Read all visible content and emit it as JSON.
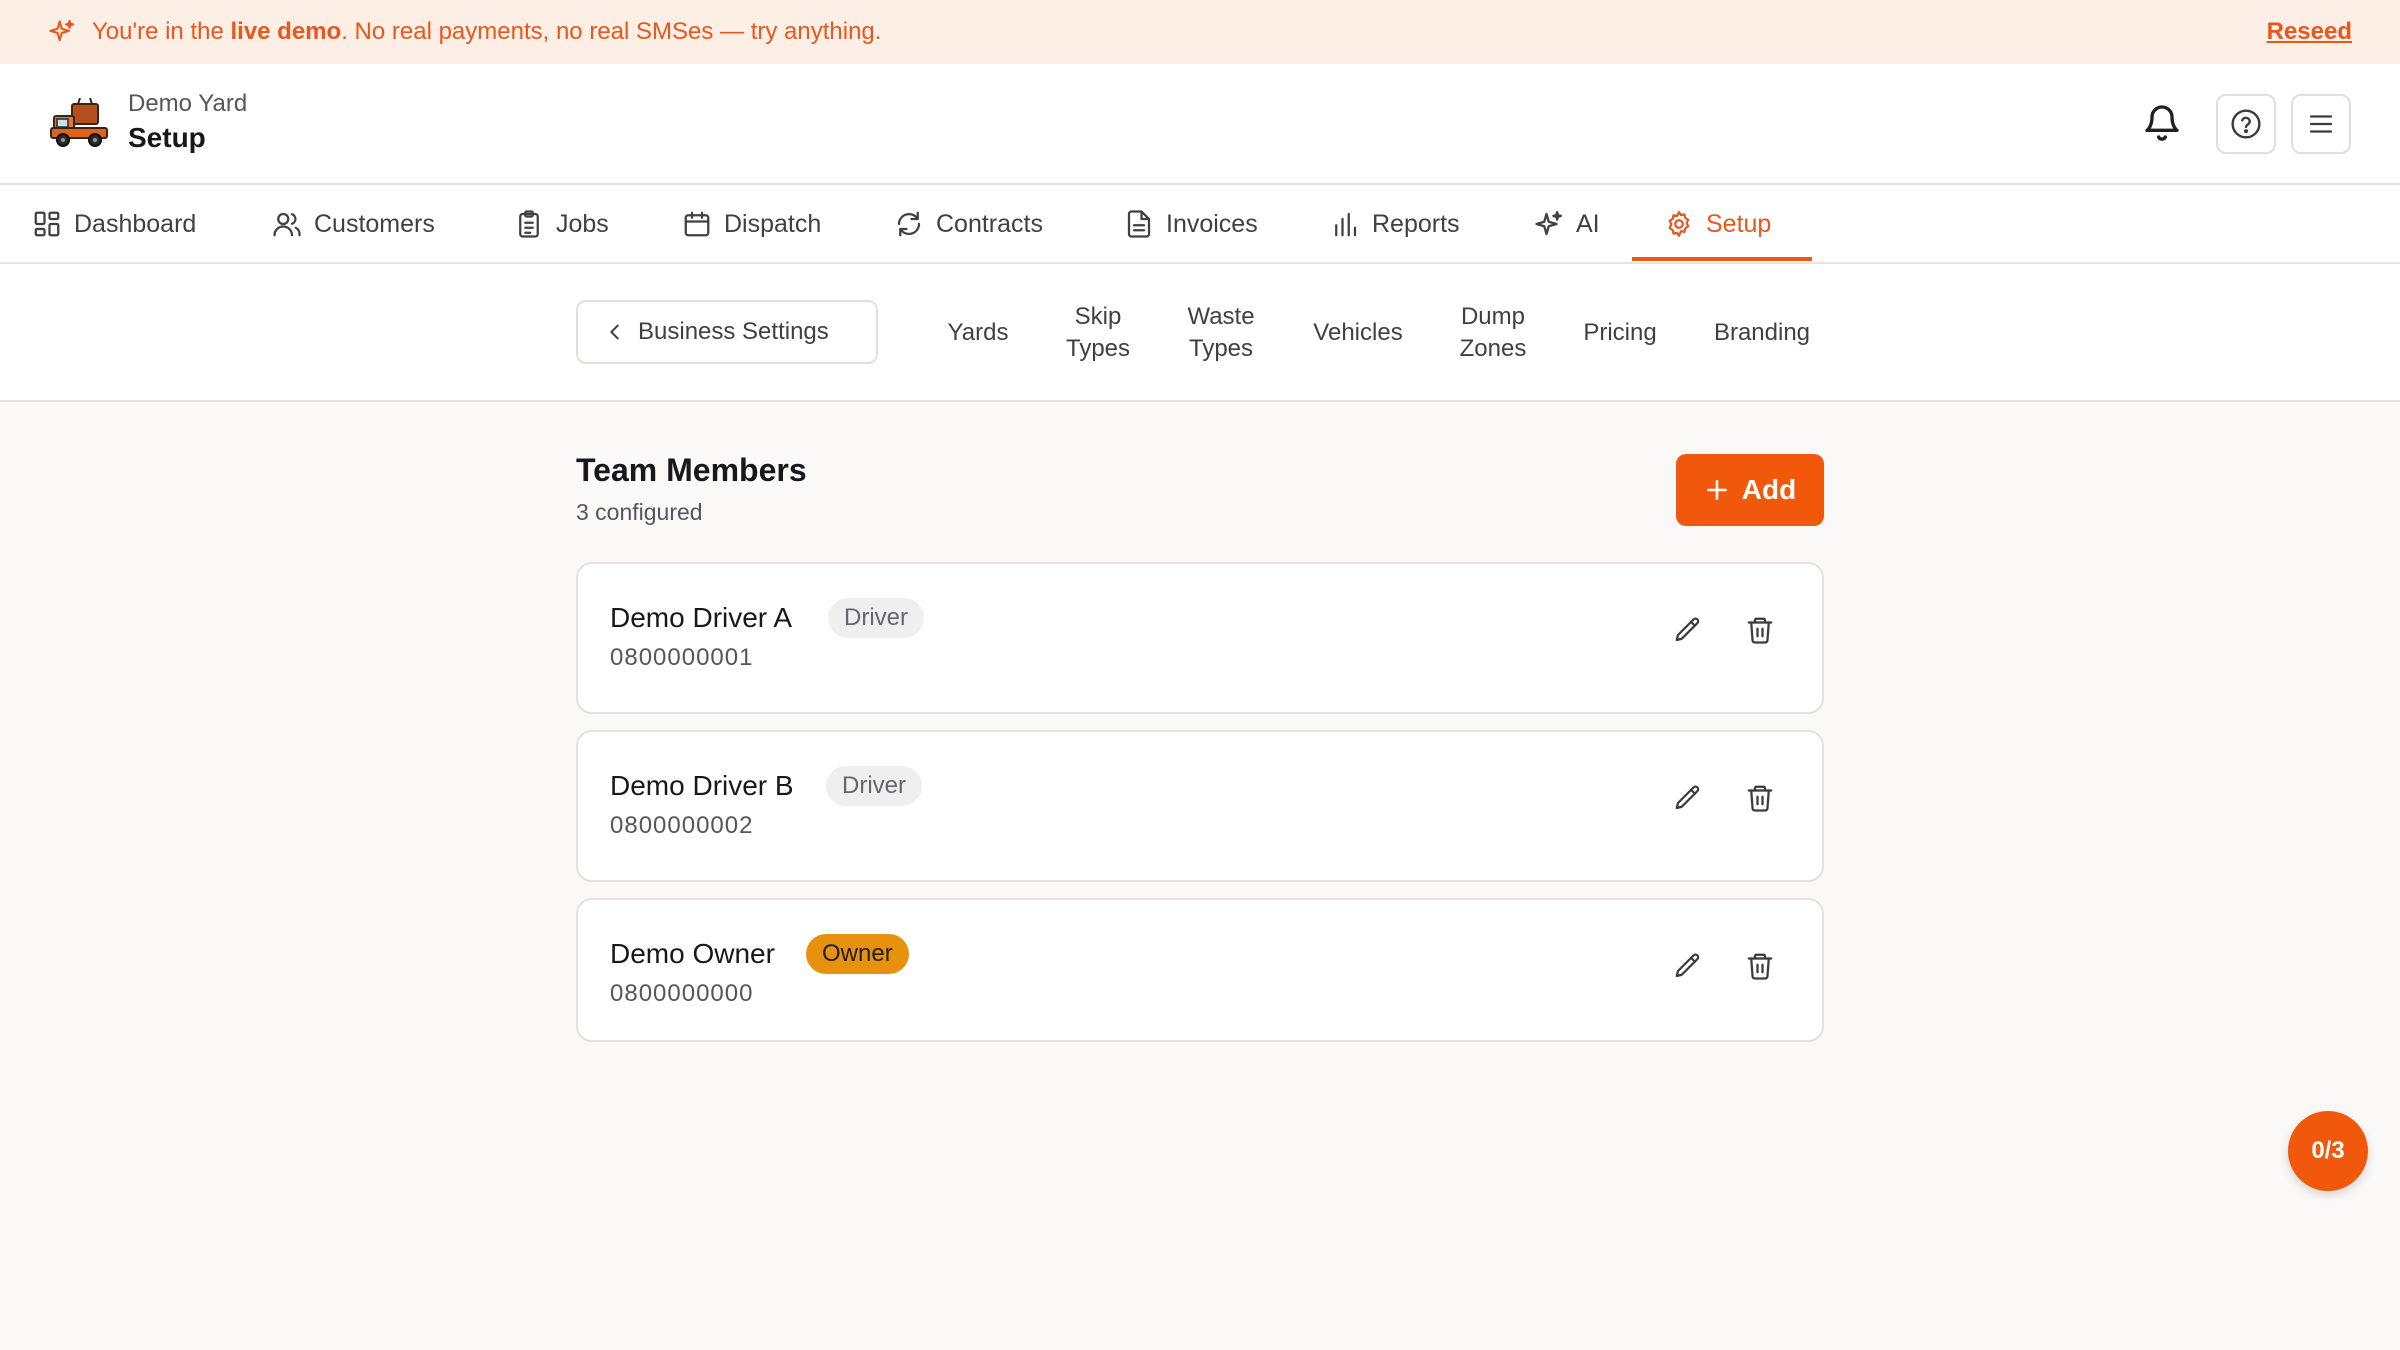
{
  "banner": {
    "prefix": "You're in the",
    "highlight": "live demo",
    "suffix": ". No real payments, no real SMSes — try anything.",
    "action": "Reseed",
    "icon": "sparkles-icon"
  },
  "header": {
    "yard_name": "Demo Yard",
    "page_title": "Setup"
  },
  "nav": {
    "items": [
      {
        "label": "Dashboard",
        "icon": "grid-icon"
      },
      {
        "label": "Customers",
        "icon": "users-icon"
      },
      {
        "label": "Jobs",
        "icon": "clipboard-icon"
      },
      {
        "label": "Dispatch",
        "icon": "calendar-icon"
      },
      {
        "label": "Contracts",
        "icon": "refresh-icon"
      },
      {
        "label": "Invoices",
        "icon": "document-icon"
      },
      {
        "label": "Reports",
        "icon": "bar-chart-icon"
      },
      {
        "label": "AI",
        "icon": "sparkles-icon"
      },
      {
        "label": "Setup",
        "icon": "gear-icon"
      }
    ],
    "active": "Setup"
  },
  "subnav": {
    "back_label": "Business Settings",
    "items": [
      {
        "label": "Yards"
      },
      {
        "label": "Skip\nTypes"
      },
      {
        "label": "Waste\nTypes"
      },
      {
        "label": "Vehicles"
      },
      {
        "label": "Dump\nZones"
      },
      {
        "label": "Pricing"
      },
      {
        "label": "Branding"
      }
    ]
  },
  "section": {
    "title": "Team Members",
    "subtitle": "3 configured",
    "add_label": "Add"
  },
  "members": [
    {
      "name": "Demo Driver A",
      "role": "Driver",
      "phone": "0800000001"
    },
    {
      "name": "Demo Driver B",
      "role": "Driver",
      "phone": "0800000002"
    },
    {
      "name": "Demo Owner",
      "role": "Owner",
      "phone": "0800000000"
    }
  ],
  "progress": {
    "label": "0/3"
  },
  "colors": {
    "accent": "#f2580c",
    "banner_bg": "#fdeee6",
    "owner_badge": "#e6920e",
    "driver_badge": "#efefef"
  }
}
